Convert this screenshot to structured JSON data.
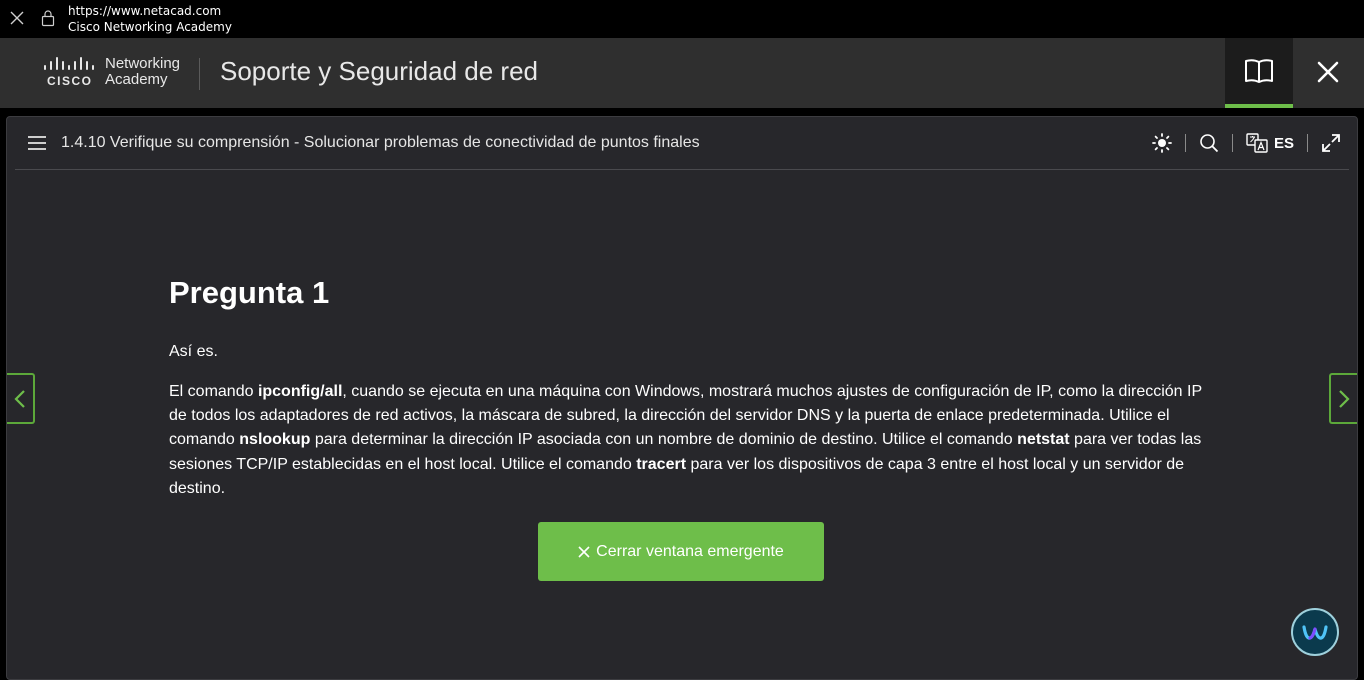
{
  "browser": {
    "url": "https://www.netacad.com",
    "site_name": "Cisco Networking Academy"
  },
  "header": {
    "logo_brand": "CISCO",
    "logo_line1": "Networking",
    "logo_line2": "Academy",
    "course_title": "Soporte y Seguridad de red"
  },
  "lesson": {
    "title": "1.4.10 Verifique su comprensión - Solucionar problemas de conectividad de puntos finales",
    "language": "ES"
  },
  "question": {
    "title": "Pregunta 1",
    "feedback_short": "Así es.",
    "feedback_parts": [
      "El comando ",
      "ipconfig/all",
      ", cuando se ejecuta en una máquina con Windows, mostrará muchos ajustes de configuración de IP, como la dirección IP de todos los adaptadores de red activos, la máscara de subred, la dirección del servidor DNS y la puerta de enlace predeterminada. Utilice el comando ",
      "nslookup",
      " para determinar la dirección IP asociada con un nombre de dominio de destino. Utilice el comando ",
      "netstat",
      " para ver todas las sesiones TCP/IP establecidas en el host local. Utilice el comando ",
      "tracert",
      " para ver los dispositivos de capa 3 entre el host local y un servidor de destino."
    ],
    "close_popup_label": "Cerrar ventana emergente"
  },
  "colors": {
    "accent_green": "#6ebe4a",
    "header_bg": "#2f2f2f",
    "content_bg": "#27272b"
  },
  "icons": {
    "browser_close": "close-icon",
    "browser_lock": "lock-icon",
    "book": "book-icon",
    "app_close": "close-icon",
    "menu": "hamburger-menu-icon",
    "theme": "sun-icon",
    "search": "search-icon",
    "translate": "translate-icon",
    "expand": "expand-icon",
    "prev": "chevron-left-icon",
    "next": "chevron-right-icon",
    "webex": "webex-icon"
  }
}
